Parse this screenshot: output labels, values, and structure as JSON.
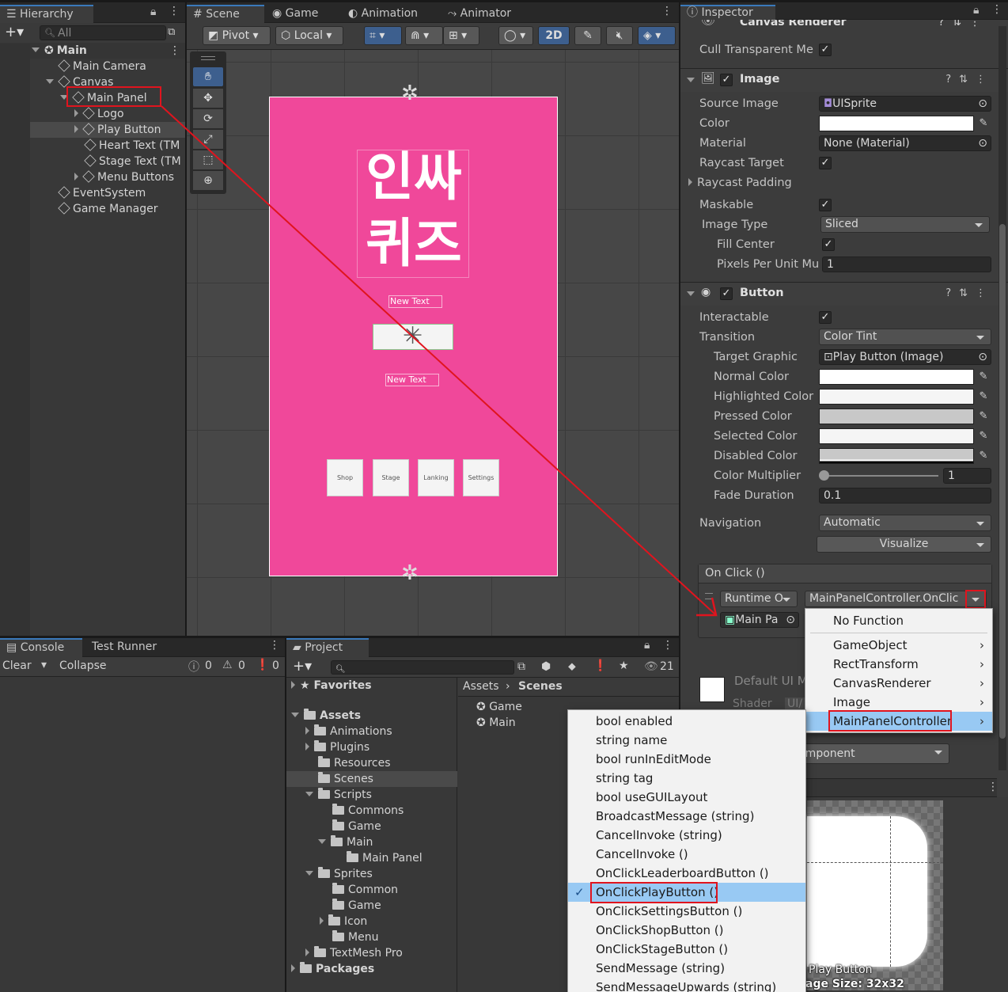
{
  "hierarchy": {
    "tab": "Hierarchy",
    "search_placeholder": "All",
    "scene": "Main",
    "items": [
      "Main Camera",
      "Canvas",
      "Main Panel",
      "Logo",
      "Play Button",
      "Heart Text (TM",
      "Stage Text (TM",
      "Menu Buttons",
      "EventSystem",
      "Game Manager"
    ]
  },
  "scene_tabs": {
    "scene": "Scene",
    "game": "Game",
    "animation": "Animation",
    "animator": "Animator"
  },
  "scene_toolbar": {
    "pivot": "Pivot",
    "local": "Local",
    "mode_2d": "2D"
  },
  "canvas": {
    "bg_color": "#f0489a",
    "logo_line1": "인싸",
    "logo_line2": "퀴즈",
    "text1": "New Text",
    "text2": "New Text",
    "buttons": [
      "Shop",
      "Stage",
      "Lanking",
      "Settings"
    ]
  },
  "inspector": {
    "tab": "Inspector",
    "canvas_renderer": {
      "title": "Canvas Renderer",
      "cull_label": "Cull Transparent Me"
    },
    "image": {
      "title": "Image",
      "source_image_label": "Source Image",
      "source_image_value": "UISprite",
      "color_label": "Color",
      "material_label": "Material",
      "material_value": "None (Material)",
      "raycast_target_label": "Raycast Target",
      "raycast_padding_label": "Raycast Padding",
      "maskable_label": "Maskable",
      "image_type_label": "Image Type",
      "image_type_value": "Sliced",
      "fill_center_label": "Fill Center",
      "ppu_label": "Pixels Per Unit Mu",
      "ppu_value": "1"
    },
    "button": {
      "title": "Button",
      "interactable_label": "Interactable",
      "transition_label": "Transition",
      "transition_value": "Color Tint",
      "target_graphic_label": "Target Graphic",
      "target_graphic_value": "Play Button (Image)",
      "normal_label": "Normal Color",
      "highlighted_label": "Highlighted Color",
      "pressed_label": "Pressed Color",
      "selected_label": "Selected Color",
      "disabled_label": "Disabled Color",
      "multiplier_label": "Color Multiplier",
      "multiplier_value": "1",
      "fade_label": "Fade Duration",
      "fade_value": "0.1",
      "navigation_label": "Navigation",
      "navigation_value": "Automatic",
      "visualize": "Visualize"
    },
    "onclick": {
      "title": "On Click ()",
      "runtime": "Runtime O",
      "function": "MainPanelController.OnClic",
      "object": "Main Pa"
    },
    "default_ui": "Default UI M",
    "shader": "Shader",
    "shader_value": "UI/",
    "add_component": "d Component",
    "preview_label": "Play Button",
    "preview_size": "age Size: 32x32"
  },
  "component_menu": {
    "items": [
      "No Function",
      "GameObject",
      "RectTransform",
      "CanvasRenderer",
      "Image",
      "MainPanelController"
    ]
  },
  "function_menu": {
    "items": [
      "bool enabled",
      "string name",
      "bool runInEditMode",
      "string tag",
      "bool useGUILayout",
      "BroadcastMessage (string)",
      "CancelInvoke (string)",
      "CancelInvoke ()",
      "OnClickLeaderboardButton ()",
      "OnClickPlayButton ()",
      "OnClickSettingsButton ()",
      "OnClickShopButton ()",
      "OnClickStageButton ()",
      "SendMessage (string)",
      "SendMessageUpwards (string)"
    ],
    "selected": "OnClickPlayButton ()"
  },
  "console": {
    "tab": "Console",
    "tab2": "Test Runner",
    "clear": "Clear",
    "collapse": "Collapse",
    "count_info": "0",
    "count_warn": "0",
    "count_err": "0"
  },
  "project": {
    "tab": "Project",
    "hidden_count": "21",
    "favorites": "Favorites",
    "tree": [
      "Assets",
      "Animations",
      "Plugins",
      "Resources",
      "Scenes",
      "Scripts",
      "Commons",
      "Game",
      "Main",
      "Main Panel",
      "Sprites",
      "Common",
      "Game",
      "Icon",
      "Menu",
      "TextMesh Pro",
      "Packages"
    ],
    "breadcrumb_root": "Assets",
    "breadcrumb_current": "Scenes",
    "files": [
      "Game",
      "Main"
    ]
  }
}
